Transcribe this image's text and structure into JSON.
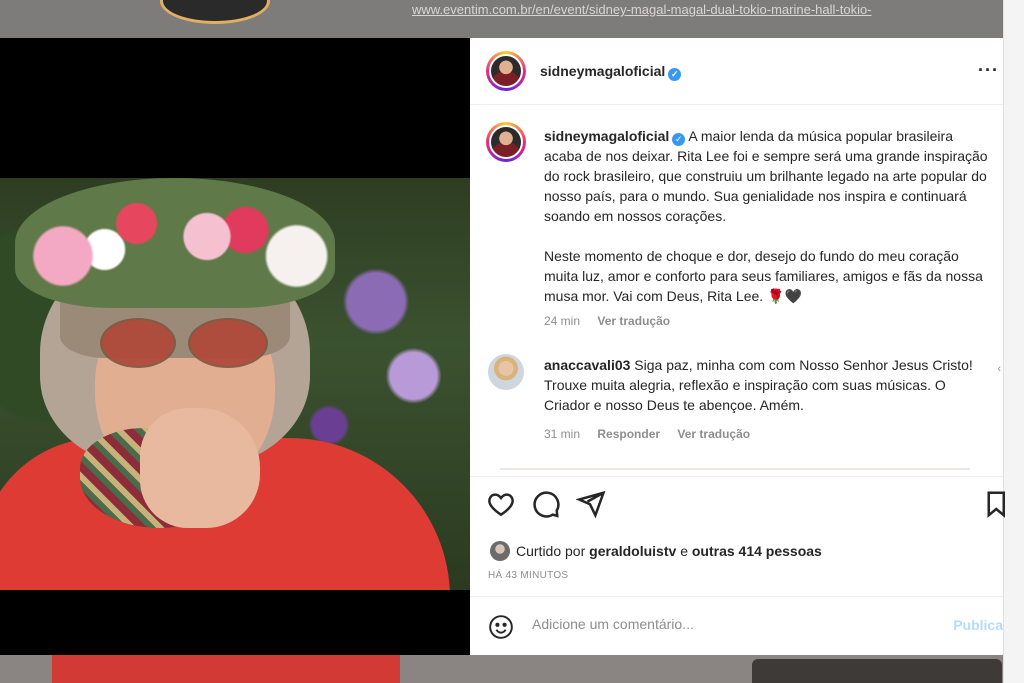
{
  "background": {
    "url_text": "www.eventim.com.br/en/event/sidney-magal-magal-dual-tokio-marine-hall-tokio-"
  },
  "post": {
    "username": "sidneymagaloficial",
    "caption": {
      "username": "sidneymagaloficial",
      "paragraph1": "A maior lenda da música popular brasileira acaba de nos deixar. Rita Lee foi e sempre será uma grande inspiração do rock brasileiro, que construiu um brilhante legado na arte popular do nosso país, para o mundo. Sua genialidade nos inspira e continuará soando em nossos corações.",
      "paragraph2": "Neste momento de choque e dor, desejo do fundo do meu coração muita luz, amor e conforto para seus familiares, amigos e fãs da nossa musa mor. Vai com Deus, Rita Lee. 🌹🖤",
      "time": "24 min",
      "translate": "Ver tradução"
    },
    "comment": {
      "username": "anaccavali03",
      "text": "Siga paz, minha com com Nosso Senhor Jesus Cristo! Trouxe muita alegria, reflexão e inspiração com suas músicas. O Criador e nosso Deus te abençoe. Amém.",
      "time": "31 min",
      "reply": "Responder",
      "translate": "Ver tradução"
    },
    "likes": {
      "prefix": "Curtido por",
      "user": "geraldoluistv",
      "middle": "e",
      "others": "outras 414 pessoas"
    },
    "time_ago": "HÁ 43 MINUTOS",
    "add_comment": {
      "placeholder": "Adicione um comentário...",
      "publish": "Publica"
    }
  },
  "icons": {
    "verified": "verified-check-icon",
    "more": "more-options-icon",
    "like": "heart-icon",
    "comment": "speech-bubble-icon",
    "share": "paper-plane-icon",
    "save": "bookmark-icon",
    "emoji": "smiley-icon"
  },
  "colors": {
    "verified": "#3897f0",
    "publish_disabled": "#b3dbff",
    "muted_text": "#8e8e8e",
    "text": "#262626"
  }
}
